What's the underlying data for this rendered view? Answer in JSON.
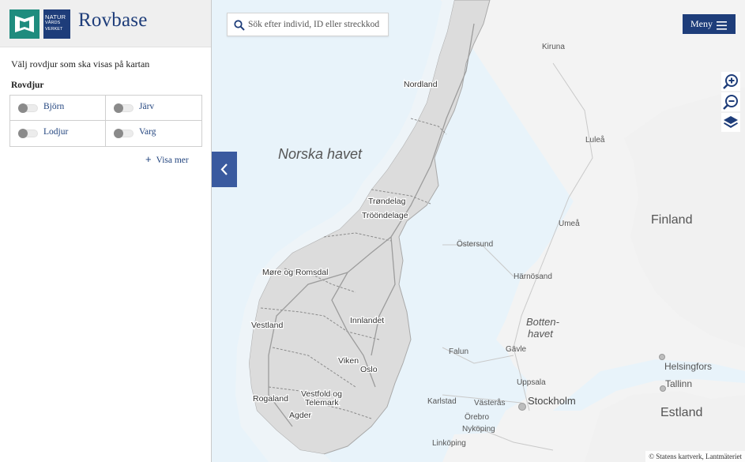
{
  "app": {
    "title": "Rovbase",
    "logo_text": [
      "NATUR",
      "VÅRDS",
      "VERKET"
    ]
  },
  "sidebar": {
    "intro": "Välj rovdjur som ska visas på kartan",
    "group_title": "Rovdjur",
    "predators": [
      {
        "label": "Björn",
        "enabled": false
      },
      {
        "label": "Järv",
        "enabled": false
      },
      {
        "label": "Lodjur",
        "enabled": false
      },
      {
        "label": "Varg",
        "enabled": false
      }
    ],
    "show_more": "Visa mer"
  },
  "search": {
    "placeholder": "Sök efter individ, ID eller streckkod",
    "value": ""
  },
  "menu": {
    "label": "Meny"
  },
  "map_tools": [
    "zoom-in-icon",
    "zoom-out-icon",
    "layers-icon"
  ],
  "map": {
    "sea_labels": {
      "norwegian_sea": "Norska havet",
      "bothnian_sea": [
        "Botten-",
        "havet"
      ]
    },
    "countries": {
      "finland": "Finland",
      "estonia": "Estland"
    },
    "regions": [
      "Nordland",
      "Trøndelag",
      "Trööndelage",
      "Møre og Romsdal",
      "Vestland",
      "Innlandet",
      "Viken",
      "Oslo",
      "Rogaland",
      "Vestfold og",
      "Telemark",
      "Agder"
    ],
    "cities": [
      "Kiruna",
      "Luleå",
      "Umeå",
      "Östersund",
      "Härnösand",
      "Gävle",
      "Falun",
      "Uppsala",
      "Stockholm",
      "Karlstad",
      "Västerås",
      "Örebro",
      "Nyköping",
      "Linköping",
      "Helsingfors",
      "Tallinn"
    ]
  },
  "attribution": "© Statens kartverk, Lantmäteriet",
  "colors": {
    "brand_blue": "#1e3d7a",
    "brand_green": "#1f8c7e",
    "collapse_blue": "#3a5a9f",
    "water": "#e8f3fa",
    "land": "#f3f3f3",
    "norway": "#d9d9d9"
  }
}
